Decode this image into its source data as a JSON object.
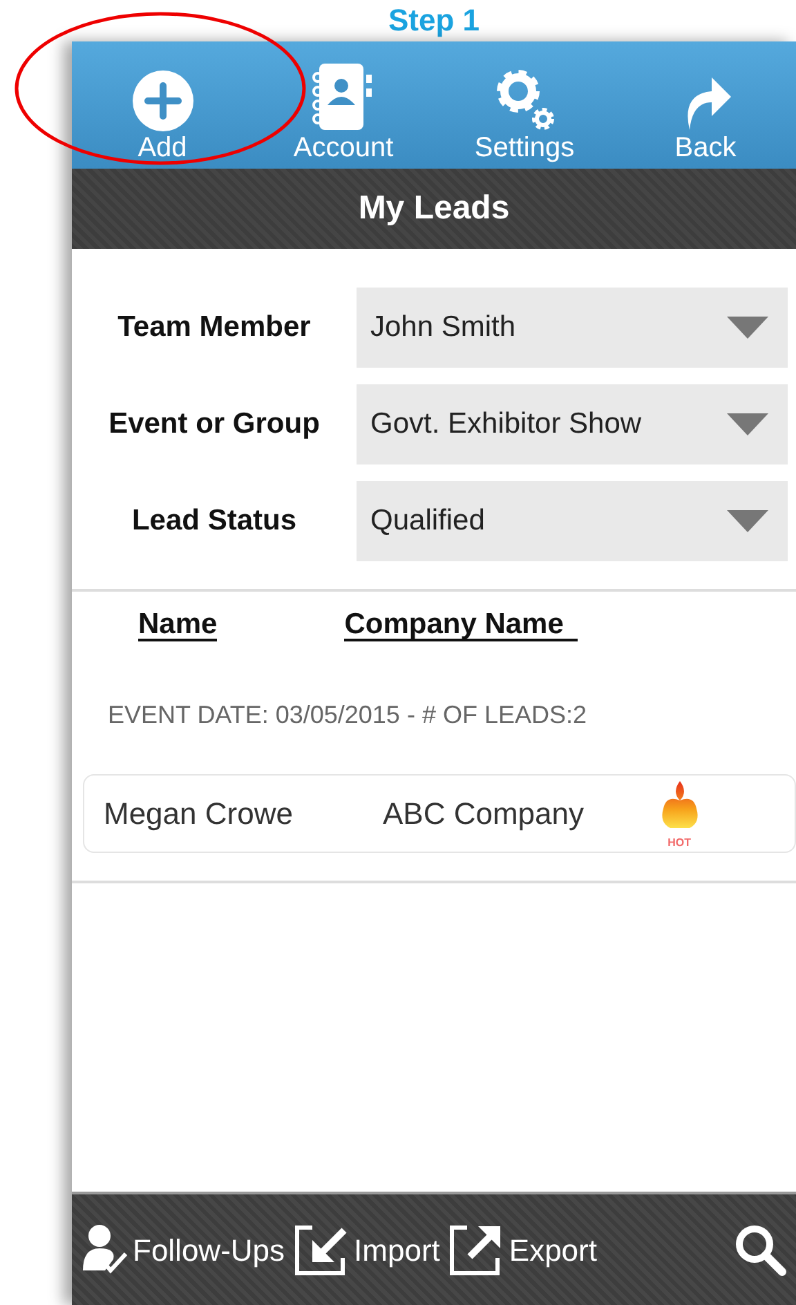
{
  "heading": "Step 1",
  "toolbar": [
    {
      "label": "Add",
      "kind": "add",
      "circled": true
    },
    {
      "label": "Account",
      "kind": "account",
      "circled": false
    },
    {
      "label": "Settings",
      "kind": "settings",
      "circled": false
    },
    {
      "label": "Back",
      "kind": "back",
      "circled": false
    }
  ],
  "title": "My Leads",
  "filters": [
    {
      "label": "Team Member",
      "value": "John Smith"
    },
    {
      "label": "Event or Group",
      "value": "Govt. Exhibitor Show"
    },
    {
      "label": "Lead Status",
      "value": "Qualified"
    }
  ],
  "columns": [
    "Name",
    "Company Name"
  ],
  "event_summary": "EVENT DATE: 03/05/2015 - # OF LEADS:2",
  "leads": [
    {
      "name": "Megan Crowe",
      "company": "ABC Company",
      "rating": "HOT"
    }
  ],
  "bottom_bar": [
    {
      "label": "Follow-Ups",
      "kind": "follow-ups"
    },
    {
      "label": "Import",
      "kind": "import"
    },
    {
      "label": "Export",
      "kind": "export"
    },
    {
      "kind": "search"
    }
  ]
}
